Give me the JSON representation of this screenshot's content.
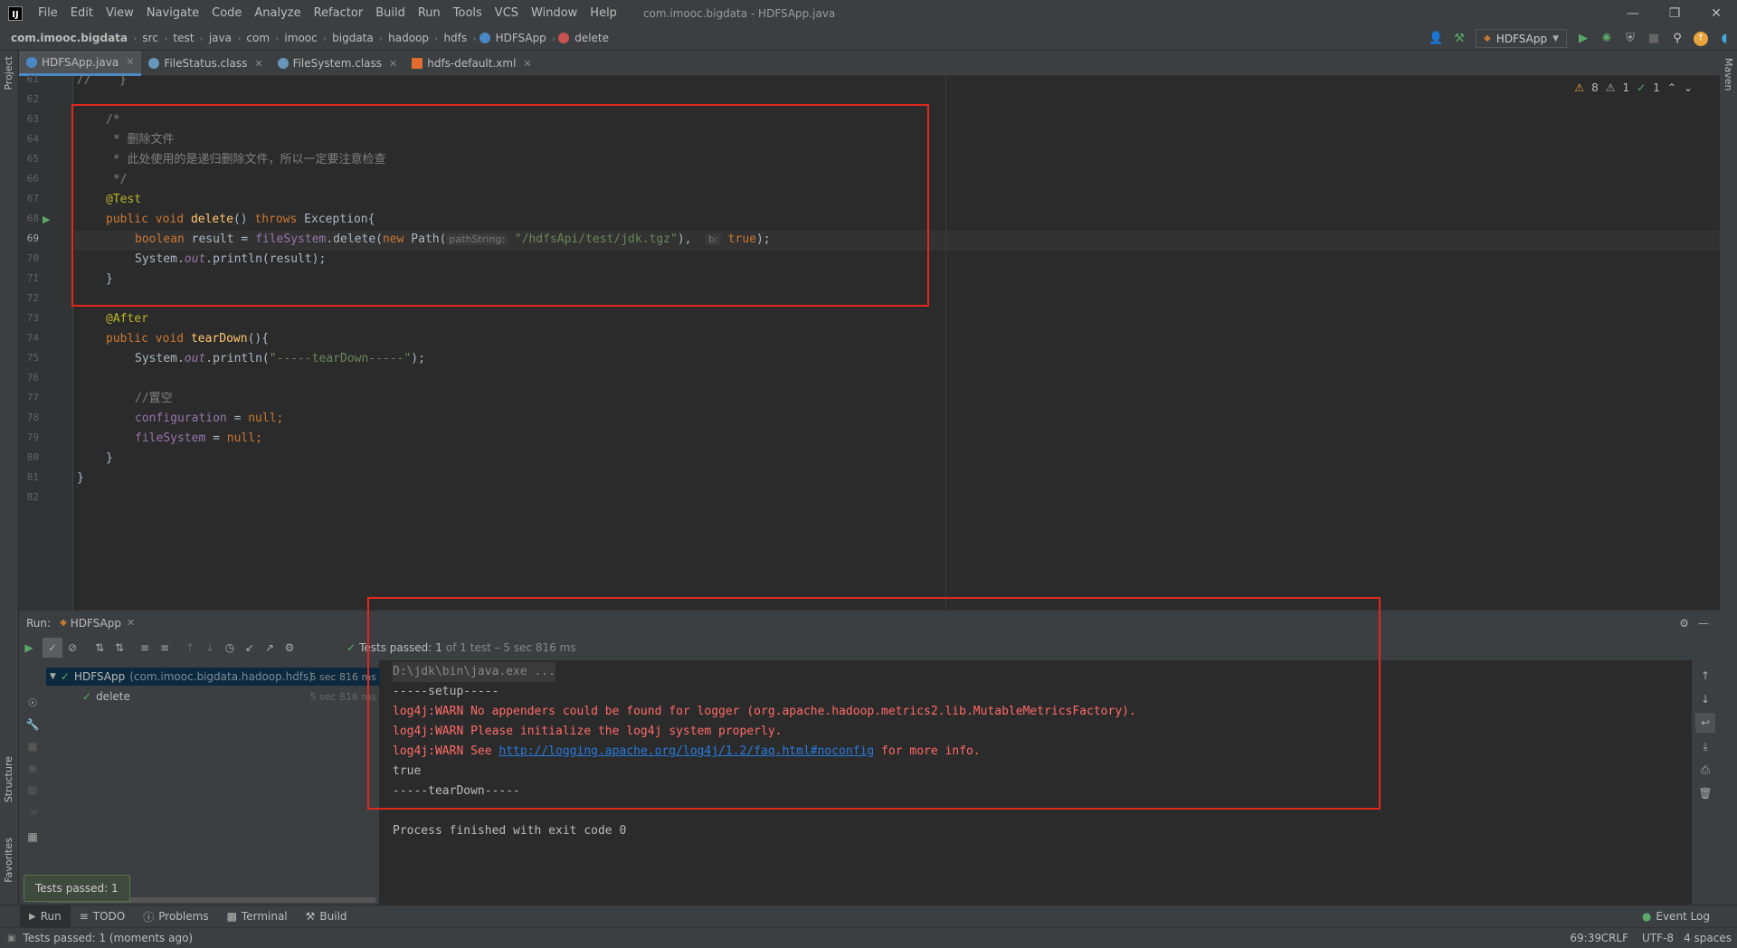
{
  "menubar": {
    "items": [
      "File",
      "Edit",
      "View",
      "Navigate",
      "Code",
      "Analyze",
      "Refactor",
      "Build",
      "Run",
      "Tools",
      "VCS",
      "Window",
      "Help"
    ],
    "window_title": "com.imooc.bigdata - HDFSApp.java"
  },
  "breadcrumb": {
    "root": "com.imooc.bigdata",
    "parts": [
      "src",
      "test",
      "java",
      "com",
      "imooc",
      "bigdata",
      "hadoop",
      "hdfs",
      "HDFSApp",
      "delete"
    ]
  },
  "run_config": {
    "label": "HDFSApp"
  },
  "side_labels": {
    "project": "Project",
    "structure": "Structure",
    "favorites": "Favorites",
    "maven": "Maven"
  },
  "tabs": [
    {
      "label": "HDFSApp.java",
      "icon": "class-icon",
      "color": "#4a88c7"
    },
    {
      "label": "FileStatus.class",
      "icon": "compiled-class-icon",
      "color": "#6897bb"
    },
    {
      "label": "FileSystem.class",
      "icon": "compiled-class-icon",
      "color": "#6897bb"
    },
    {
      "label": "hdfs-default.xml",
      "icon": "xml-icon",
      "color": "#e06c2f"
    }
  ],
  "inspections": {
    "warnings": "8",
    "weak": "1",
    "ok": "1"
  },
  "editor": {
    "line_numbers": [
      "61",
      "62",
      "63",
      "64",
      "65",
      "66",
      "67",
      "68",
      "69",
      "70",
      "71",
      "72",
      "73",
      "74",
      "75",
      "76",
      "77",
      "78",
      "79",
      "80",
      "81",
      "82"
    ],
    "line61": "//    }",
    "c63": "/*",
    "c64": " * 删除文件",
    "c65": " * 此处使用的是递归删除文件，所以一定要注意检查",
    "c66": " */",
    "ann_test": "@Test",
    "kw_public": "public",
    "kw_void": "void",
    "m_delete": "delete",
    "l68_rest": "() ",
    "kw_throws": "throws",
    "l68_exc": " Exception{",
    "kw_boolean": "boolean",
    "l69_a": " result = ",
    "f_fs": "fileSystem",
    "l69_b": ".delete(",
    "kw_new": "new",
    "l69_c": " Path(",
    "hint_path": "pathString:",
    "s_path": "\"/hdfsApi/test/jdk.tgz\"",
    "l69_d": "),  ",
    "hint_b": "b:",
    "kw_true": "true",
    "l69_e": ");",
    "sys": "System.",
    "f_out": "out",
    "l70_rest": ".println(result);",
    "brace": "}",
    "ann_after": "@After",
    "m_teardown": "tearDown",
    "l74_rest": "(){",
    "l75_rest": ".println(",
    "s_teardown": "\"-----tearDown-----\"",
    "l75_end": ");",
    "c77": "//置空",
    "f_conf": "configuration",
    "eq": " = ",
    "kw_null": "null",
    "semi": ";",
    "f_fs2": "fileSystem"
  },
  "run_panel": {
    "title": "Run:",
    "config_tab": "HDFSApp",
    "tests_passed_label": "Tests passed:",
    "tests_passed_count": "1",
    "tests_summary": "of 1 test – 5 sec 816 ms",
    "tree": [
      {
        "name": "HDFSApp",
        "pkg": "(com.imooc.bigdata.hadoop.hdfs)",
        "time": "5 sec 816 ms"
      },
      {
        "name": "delete",
        "time": "5 sec 816 ms"
      }
    ],
    "console": [
      "D:\\jdk\\bin\\java.exe ...",
      "-----setup-----",
      "log4j:WARN No appenders could be found for logger (org.apache.hadoop.metrics2.lib.MutableMetricsFactory).",
      "log4j:WARN Please initialize the log4j system properly.",
      "log4j:WARN See ",
      "true",
      "-----tearDown-----",
      "Process finished with exit code 0"
    ],
    "console_link": "http://logging.apache.org/log4j/1.2/faq.html#noconfig",
    "console_after_link": " for more info."
  },
  "toast": "Tests passed: 1",
  "bottom_tabs": [
    "Run",
    "TODO",
    "Problems",
    "Terminal",
    "Build"
  ],
  "event_log": "Event Log",
  "status": {
    "message": "Tests passed: 1 (moments ago)",
    "position": "69:39",
    "line_sep": "CRLF",
    "encoding": "UTF-8",
    "indent": "4 spaces"
  }
}
